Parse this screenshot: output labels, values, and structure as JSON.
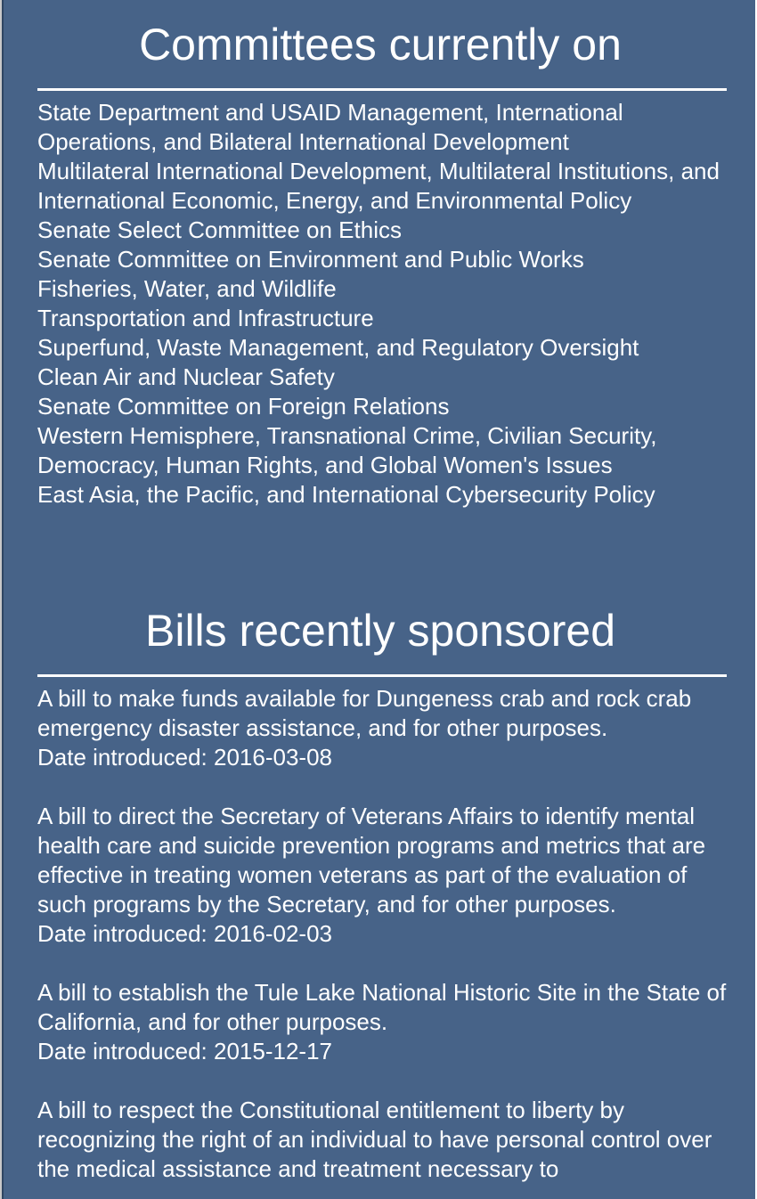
{
  "committees": {
    "title": "Committees currently on",
    "items": [
      "State Department and USAID Management, International Operations, and Bilateral International Development",
      "Multilateral International Development, Multilateral Institutions, and International Economic, Energy, and Environmental Policy",
      "Senate Select Committee on Ethics",
      "Senate Committee on Environment and Public Works",
      "Fisheries, Water, and Wildlife",
      "Transportation and Infrastructure",
      "Superfund, Waste Management, and Regulatory Oversight",
      "Clean Air and Nuclear Safety",
      "Senate Committee on Foreign Relations",
      "Western Hemisphere, Transnational Crime, Civilian Security, Democracy, Human Rights, and Global Women's Issues",
      "East Asia, the Pacific, and International Cybersecurity Policy"
    ]
  },
  "bills": {
    "title": "Bills recently sponsored",
    "items": [
      {
        "title": "A bill to make funds available for Dungeness crab and rock crab emergency disaster assistance, and for other purposes.",
        "date": "Date introduced: 2016-03-08"
      },
      {
        "title": "A bill to direct the Secretary of Veterans Affairs to identify mental health care and suicide prevention programs and metrics that are effective in treating women veterans as part of the evaluation of such programs by the Secretary, and for other purposes.",
        "date": "Date introduced: 2016-02-03"
      },
      {
        "title": "A bill to establish the Tule Lake National Historic Site in the State of California, and for other purposes.",
        "date": "Date introduced: 2015-12-17"
      },
      {
        "title": "A bill to respect the Constitutional entitlement to liberty by recognizing the right of an individual to have personal control over the medical assistance and treatment necessary to",
        "date": ""
      }
    ]
  }
}
